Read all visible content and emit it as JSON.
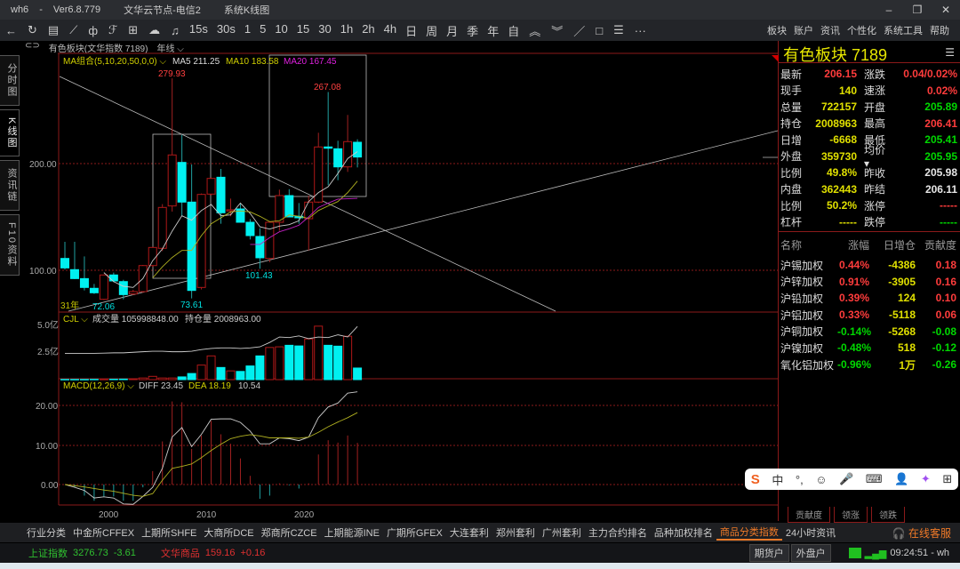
{
  "window": {
    "app": "wh6",
    "version": "Ver6.8.779",
    "server": "文华云节点-电信2",
    "view": "系统K线图",
    "min": "–",
    "max": "❐",
    "close": "✕"
  },
  "toolbar": {
    "icons": [
      "←",
      "↻",
      "▤",
      "⟋",
      "ф",
      "ℱ",
      "⊞",
      "☁",
      "♫"
    ],
    "periods": [
      "15s",
      "30s",
      "1",
      "5",
      "10",
      "15",
      "30",
      "1h",
      "2h",
      "4h",
      "日",
      "周",
      "月",
      "季",
      "年",
      "自"
    ],
    "tools": [
      "︽",
      "︾",
      "／",
      "□",
      "☰",
      "···"
    ],
    "menus": [
      "板块",
      "账户",
      "资讯",
      "个性化",
      "系统工具",
      "帮助"
    ]
  },
  "header": {
    "instrument": "有色板块(文华指数 7189)",
    "period": "年线 ⌵"
  },
  "left_tabs": [
    "分时图",
    "K线图",
    "资讯链",
    "F10资料"
  ],
  "main": {
    "ma_label": "MA组合(5,10,20,50,0,0) ⌵",
    "ma5": "MA5 211.25",
    "ma10": "MA10 183.58",
    "ma20": "MA20 167.45",
    "y_labels": [
      "200.00",
      "100.00"
    ],
    "hi1": "279.93",
    "hi2": "267.08",
    "lo1": "72.06",
    "lo2": "73.61",
    "lo3": "101.43",
    "count": "31年"
  },
  "volume": {
    "label": "CJL ⌵",
    "vol": "成交量 105998848.00",
    "oi": "持仓量 2008963.00",
    "y_labels": [
      "5.0亿",
      "2.5亿"
    ]
  },
  "macd": {
    "label": "MACD(12,26,9) ⌵",
    "diff": "DIFF 23.45",
    "dea": "DEA 18.19",
    "macd": "10.54",
    "y_labels": [
      "20.00",
      "10.00",
      "0.00"
    ]
  },
  "x_labels": [
    "2000",
    "2010",
    "2020"
  ],
  "colors": {
    "up": "#b01818",
    "down": "#00f0f0",
    "ma5": "#cccccc",
    "ma10": "#b0b020",
    "ma20": "#c020c0"
  },
  "chart_data": {
    "type": "candlestick",
    "years": [
      1995,
      1996,
      1997,
      1998,
      1999,
      2000,
      2001,
      2002,
      2003,
      2004,
      2005,
      2006,
      2007,
      2008,
      2009,
      2010,
      2011,
      2012,
      2013,
      2014,
      2015,
      2016,
      2017,
      2018,
      2019,
      2020,
      2021,
      2022,
      2023,
      2024,
      2025
    ],
    "ohlc": [
      [
        111.1,
        126.7,
        100.6,
        102.2
      ],
      [
        100.6,
        126.7,
        91.7,
        92.2
      ],
      [
        92.2,
        113,
        81.1,
        83.9
      ],
      [
        83.1,
        87.2,
        77.8,
        78.9
      ],
      [
        72.8,
        96,
        72.06,
        95.6
      ],
      [
        95.6,
        97.8,
        88.9,
        90
      ],
      [
        89.4,
        91.1,
        72.8,
        77.2
      ],
      [
        77.8,
        81.7,
        76.7,
        80
      ],
      [
        80,
        105,
        79,
        104.4
      ],
      [
        104.4,
        122,
        103,
        121.4
      ],
      [
        120.6,
        162,
        118,
        158.9
      ],
      [
        160.3,
        279.93,
        155,
        208.1
      ],
      [
        201.1,
        226.9,
        150.6,
        163.9
      ],
      [
        163.9,
        199.2,
        73.61,
        81.1
      ],
      [
        83.9,
        172,
        82,
        171.1
      ],
      [
        171.4,
        187,
        170,
        186.1
      ],
      [
        187.2,
        195,
        143.6,
        153.9
      ],
      [
        155.6,
        167.2,
        150.6,
        156.7
      ],
      [
        157.5,
        163,
        145,
        145
      ],
      [
        145,
        148,
        128.9,
        132.5
      ],
      [
        131.7,
        139.4,
        101.43,
        111.7
      ],
      [
        111.1,
        146,
        107.5,
        145
      ],
      [
        145,
        175.6,
        137,
        170
      ],
      [
        170,
        176,
        150,
        150
      ],
      [
        150.6,
        163,
        143.6,
        149.2
      ],
      [
        148.3,
        170,
        118.6,
        163.9
      ],
      [
        163.9,
        228.9,
        163,
        215.6
      ],
      [
        215.6,
        267.08,
        179.7,
        214.4
      ],
      [
        213.9,
        221.4,
        184.4,
        196.9
      ],
      [
        196.9,
        245.6,
        192.2,
        220.6
      ],
      [
        220,
        222.8,
        196.4,
        206.15
      ]
    ],
    "ma5": [
      null,
      null,
      null,
      null,
      97.8,
      89.4,
      85,
      83.9,
      92.2,
      108.9,
      120,
      136.7,
      151.1,
      146.9,
      156,
      161.7,
      151.1,
      151.9,
      163,
      153.3,
      140.8,
      138.6,
      141.4,
      142.8,
      146.4,
      164.4,
      172.8,
      178.3,
      190.8,
      204.7,
      211.25
    ],
    "ma10": [
      null,
      null,
      null,
      null,
      null,
      null,
      null,
      null,
      null,
      92.8,
      103.3,
      112,
      118.6,
      118.6,
      132.5,
      143.6,
      149.2,
      154.7,
      155.6,
      154.7,
      150.6,
      145.6,
      146.4,
      151.9,
      150.6,
      148.6,
      156,
      160.3,
      164.4,
      172.8,
      183.58
    ],
    "ma20": [
      null,
      null,
      null,
      null,
      null,
      null,
      null,
      null,
      null,
      null,
      null,
      null,
      null,
      null,
      null,
      null,
      null,
      null,
      null,
      124.2,
      124.2,
      130.6,
      136.1,
      138.9,
      142.2,
      150,
      158.9,
      163,
      166.7,
      167,
      167.45
    ],
    "volume_yi": [
      0.02,
      0.02,
      0.02,
      0.03,
      0.03,
      0.04,
      0.05,
      0.08,
      0.15,
      0.3,
      0.15,
      0.15,
      0.25,
      0.56,
      1.33,
      2.17,
      1.11,
      0.8,
      0.75,
      1.25,
      2.17,
      2.94,
      3.0,
      3.14,
      3.08,
      3.72,
      4.89,
      3.14,
      3.06,
      3.97,
      1.06
    ],
    "oi_line_yi": [
      2.4,
      2.4,
      2.4,
      2.4,
      2.42,
      2.45,
      2.45,
      2.5,
      2.55,
      2.6,
      2.6,
      2.55,
      2.55,
      2.6,
      2.75,
      2.85,
      2.9,
      2.9,
      2.85,
      2.9,
      3.0,
      3.4,
      3.9,
      3.85,
      4.0,
      3.75,
      3.9,
      3.85,
      4.1,
      3.9,
      4.86
    ],
    "diff": [
      0,
      -0.7,
      -1.5,
      -3.4,
      -3.1,
      -3.4,
      -4.9,
      -5.0,
      -3.0,
      -0.7,
      4.1,
      12,
      14.4,
      9.6,
      12.7,
      16.5,
      16.6,
      16.6,
      15.7,
      13.5,
      10.3,
      10.3,
      11.8,
      11.6,
      11.1,
      12,
      16.9,
      19.6,
      20.6,
      23.1,
      23.45
    ],
    "dea": [
      0,
      -0.3,
      -0.6,
      -1,
      -1.4,
      -1.7,
      -2.2,
      -2.7,
      -3,
      -2.3,
      1.1,
      4.1,
      4.6,
      5.2,
      6.8,
      8.6,
      10.2,
      11.6,
      12.2,
      12.6,
      12.3,
      11.8,
      11.8,
      11.8,
      11.7,
      12,
      13.2,
      14.6,
      15.8,
      16.9,
      18.19
    ],
    "macd_hist": [
      0,
      -0.6,
      -2.8,
      -4.1,
      -3,
      -3,
      -4.1,
      -4.1,
      -0.7,
      3.4,
      10.9,
      21,
      20.8,
      9,
      12.4,
      16.1,
      12.7,
      10.3,
      6.6,
      2.2,
      -3.6,
      -2.8,
      0.3,
      -0.2,
      -1,
      0.3,
      7.6,
      11.2,
      10.6,
      12.4,
      10.54
    ],
    "ylim_price": [
      60,
      300
    ],
    "ylim_volume": [
      0,
      5.0
    ],
    "ylim_macd": [
      -7,
      25
    ]
  },
  "right": {
    "title": "有色板块  7189",
    "menu_icon": "☰",
    "quotes": [
      [
        "最新",
        "206.15",
        "red",
        "涨跌",
        "0.04/0.02%",
        "red"
      ],
      [
        "现手",
        "140",
        "yel",
        "速涨",
        "0.02%",
        "red"
      ],
      [
        "总量",
        "722157",
        "yel",
        "开盘",
        "205.89",
        "grn"
      ],
      [
        "持仓",
        "2008963",
        "yel",
        "最高",
        "206.41",
        "red"
      ],
      [
        "日增",
        "-6668",
        "yel",
        "最低",
        "205.41",
        "grn"
      ],
      [
        "外盘",
        "359730",
        "yel",
        "均价 ▾",
        "205.95",
        "grn"
      ],
      [
        "比例",
        "49.8%",
        "yel",
        "昨收",
        "205.98",
        "wht"
      ],
      [
        "内盘",
        "362443",
        "yel",
        "昨结",
        "206.11",
        "wht"
      ],
      [
        "比例",
        "50.2%",
        "yel",
        "涨停",
        "-----",
        "red"
      ],
      [
        "杠杆",
        "-----",
        "yel",
        "跌停",
        "-----",
        "grn"
      ]
    ],
    "list_head": [
      "名称",
      "涨幅",
      "日增仓",
      "贡献度"
    ],
    "list": [
      [
        "沪锡加权",
        "0.44%",
        "-4386",
        "0.18",
        "red"
      ],
      [
        "沪锌加权",
        "0.91%",
        "-3905",
        "0.16",
        "red"
      ],
      [
        "沪铅加权",
        "0.39%",
        "124",
        "0.10",
        "red"
      ],
      [
        "沪铝加权",
        "0.33%",
        "-5118",
        "0.06",
        "red"
      ],
      [
        "沪铜加权",
        "-0.14%",
        "-5268",
        "-0.08",
        "grn"
      ],
      [
        "沪镍加权",
        "-0.48%",
        "518",
        "-0.12",
        "grn"
      ],
      [
        "氧化铝加权",
        "-0.96%",
        "1万",
        "-0.26",
        "grn"
      ]
    ],
    "tabs": [
      "贡献度",
      "领涨",
      "领跌"
    ]
  },
  "ime": [
    "S",
    "中",
    "°,",
    "☺",
    "🎤",
    "⌨",
    "👤",
    "✦",
    "⊞"
  ],
  "bottom_tabs": [
    "行业分类",
    "中金所CFFEX",
    "上期所SHFE",
    "大商所DCE",
    "郑商所CZCE",
    "上期能源INE",
    "广期所GFEX",
    "大连套利",
    "郑州套利",
    "广州套利",
    "主力合约排名",
    "品种加权排名",
    "商品分类指数",
    "24小时资讯"
  ],
  "service": "🎧 在线客服",
  "status": {
    "idx1_name": "上证指数",
    "idx1_val": "3276.73",
    "idx1_chg": "-3.61",
    "idx2_name": "文华商品",
    "idx2_val": "159.16",
    "idx2_chg": "+0.16",
    "btn1": "期货户",
    "btn2": "外盘户",
    "time": "09:24:51 - wh"
  }
}
